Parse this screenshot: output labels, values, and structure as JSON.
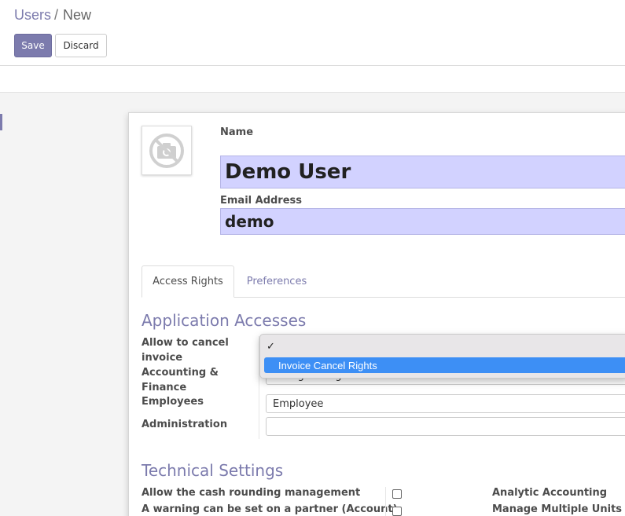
{
  "breadcrumb": {
    "parent": "Users",
    "separator": "/",
    "current": "New"
  },
  "toolbar": {
    "save_label": "Save",
    "discard_label": "Discard"
  },
  "avatar": {
    "icon": "camera-off-icon"
  },
  "name_field": {
    "label": "Name",
    "value": "Demo User"
  },
  "email_field": {
    "label": "Email Address",
    "value": "demo"
  },
  "tabs": [
    {
      "label": "Access Rights",
      "active": true
    },
    {
      "label": "Preferences",
      "active": false
    }
  ],
  "application_accesses": {
    "title": "Application Accesses",
    "rows": [
      {
        "label": "Allow to cancel invoice",
        "value": ""
      },
      {
        "label": "Accounting & Finance",
        "value": "Billing Manager"
      },
      {
        "label": "Employees",
        "value": "Employee"
      },
      {
        "label": "Administration",
        "value": ""
      }
    ],
    "dropdown": {
      "check": "✓",
      "options": [
        "Invoice Cancel Rights"
      ],
      "highlighted": "Invoice Cancel Rights"
    }
  },
  "technical_settings": {
    "title": "Technical Settings",
    "left_items": [
      "Allow the cash rounding management",
      "A warning can be set on a partner (Account)"
    ],
    "right_items": [
      "Analytic Accounting",
      "Manage Multiple Units of"
    ]
  },
  "colors": {
    "accent": "#7c7bad",
    "input_highlight": "#d2d2ff",
    "dropdown_highlight": "#3d8ff5"
  }
}
